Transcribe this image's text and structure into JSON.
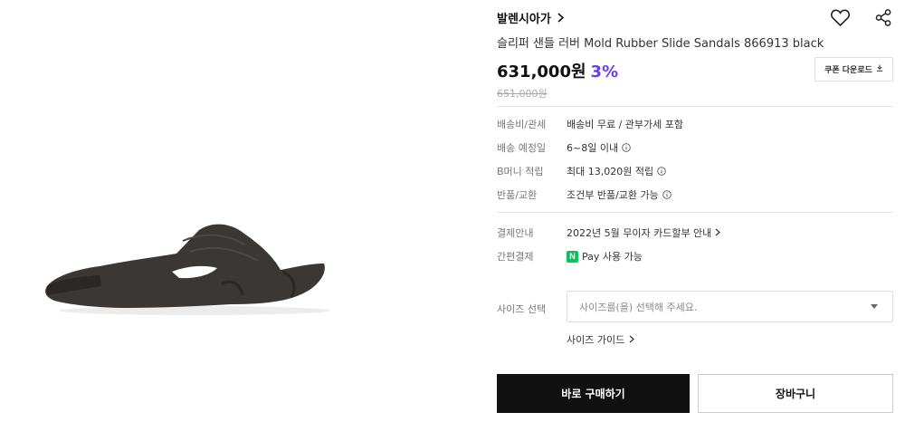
{
  "product": {
    "brand": "발렌시아가",
    "name": "슬리퍼 샌들 러버 Mold Rubber Slide Sandals 866913 black",
    "price": "631,000원",
    "discount": "3%",
    "original_price": "651,000원",
    "coupon_label": "쿠폰 다운로드"
  },
  "shipping": {
    "rows": [
      {
        "label": "배송비/관세",
        "value": "배송비 무료 / 관부가세 포함"
      },
      {
        "label": "배송 예정일",
        "value": "6~8일 이내"
      },
      {
        "label": "B머니 적립",
        "value": "최대 13,020원 적립"
      },
      {
        "label": "반품/교환",
        "value": "조건부 반품/교환 가능"
      }
    ]
  },
  "payment": {
    "rows": [
      {
        "label": "결제안내",
        "value": "2022년 5월 무이자 카드할부 안내"
      },
      {
        "label": "간편결제",
        "value": "Pay 사용 가능",
        "badge": "N"
      }
    ]
  },
  "size": {
    "label": "사이즈 선택",
    "placeholder": "사이즈를(을) 선택해 주세요.",
    "guide": "사이즈 가이드"
  },
  "actions": {
    "buy": "바로 구매하기",
    "cart": "장바구니"
  },
  "colors": {
    "discount": "#6a3de8",
    "buy_bg": "#111111",
    "npay": "#03c75a"
  },
  "icons": [
    "chevron-right-icon",
    "heart-icon",
    "share-icon",
    "download-icon",
    "info-icon",
    "chevron-down-icon",
    "naver-pay-icon"
  ]
}
